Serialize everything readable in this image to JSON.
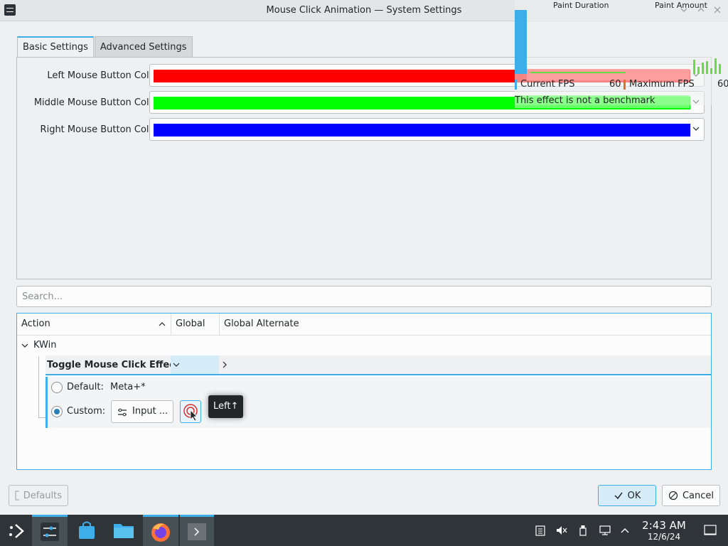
{
  "window": {
    "title": "Mouse Click Animation — System Settings"
  },
  "tabs": [
    {
      "label": "Basic Settings",
      "active": true
    },
    {
      "label": "Advanced Settings",
      "active": false
    }
  ],
  "colors": [
    {
      "label": "Left Mouse Button Color:",
      "color": "#ff0000"
    },
    {
      "label": "Middle Mouse Button Color:",
      "color": "#00ff00"
    },
    {
      "label": "Right Mouse Button Color:",
      "color": "#0000ff"
    }
  ],
  "search": {
    "placeholder": "Search..."
  },
  "shortcuts": {
    "columns": [
      "Action",
      "Global",
      "Global Alternate"
    ],
    "group": "KWin",
    "action": "Toggle Mouse Click Effect",
    "default_label": "Default:",
    "default_value": "Meta+*",
    "custom_label": "Custom:",
    "input_label": "Input ...",
    "tooltip": "Left↑"
  },
  "buttons": {
    "defaults": "Defaults",
    "ok": "OK",
    "cancel": "Cancel"
  },
  "overlay": {
    "paint_duration": "Paint Duration",
    "paint_amount": "Paint Amount",
    "current_fps_label": "Current FPS",
    "current_fps_value": "60",
    "max_fps_label": "Maximum FPS",
    "max_fps_value": "60",
    "note": "This effect is not a benchmark"
  },
  "clock": {
    "time": "2:43 AM",
    "date": "12/6/24"
  },
  "accent_color": "#3daee9"
}
